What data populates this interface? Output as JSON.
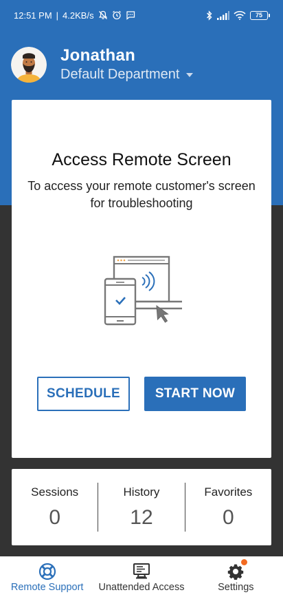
{
  "status_bar": {
    "time": "12:51 PM",
    "net_speed": "4.2KB/s",
    "battery": "75"
  },
  "header": {
    "user_name": "Jonathan",
    "department": "Default Department"
  },
  "card": {
    "title": "Access Remote Screen",
    "subtitle": "To access your remote customer's screen for troubleshooting",
    "schedule_label": "SCHEDULE",
    "start_label": "START NOW"
  },
  "stats": [
    {
      "label": "Sessions",
      "value": "0"
    },
    {
      "label": "History",
      "value": "12"
    },
    {
      "label": "Favorites",
      "value": "0"
    }
  ],
  "nav": [
    {
      "label": "Remote Support",
      "icon": "lifebuoy-icon",
      "active": true
    },
    {
      "label": "Unattended Access",
      "icon": "computer-icon",
      "active": false
    },
    {
      "label": "Settings",
      "icon": "gear-icon",
      "active": false,
      "badge": true
    }
  ],
  "colors": {
    "primary": "#2a6fb9",
    "background": "#333333",
    "badge": "#f36b22"
  }
}
